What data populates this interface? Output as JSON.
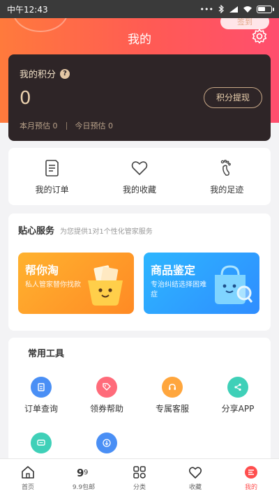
{
  "status": {
    "time": "中午12:43",
    "dots": "•••"
  },
  "header": {
    "title": "我的",
    "signin_label": "签到"
  },
  "points": {
    "label": "我的积分",
    "value": "0",
    "withdraw_label": "积分提现",
    "month_estimate": "本月预估 0",
    "today_estimate": "今日预估 0"
  },
  "quick_links": [
    {
      "label": "我的订单"
    },
    {
      "label": "我的收藏"
    },
    {
      "label": "我的足迹"
    }
  ],
  "service": {
    "title": "贴心服务",
    "subtitle": "为您提供1对1个性化管家服务",
    "tiles": [
      {
        "title": "帮你淘",
        "desc": "私人管家替你找款"
      },
      {
        "title": "商品鉴定",
        "desc": "专治纠结选择困难症"
      }
    ]
  },
  "tools": {
    "title": "常用工具",
    "items": [
      {
        "label": "订单查询",
        "color": "#4a8ff5"
      },
      {
        "label": "领券帮助",
        "color": "#ff6b7a"
      },
      {
        "label": "专属客服",
        "color": "#ffa63d"
      },
      {
        "label": "分享APP",
        "color": "#3fd0b8"
      },
      {
        "label": "",
        "color": "#3fd0b8"
      },
      {
        "label": "",
        "color": "#4a8ff5"
      }
    ]
  },
  "nav": [
    {
      "label": "首页"
    },
    {
      "label": "9.9包邮"
    },
    {
      "label": "分类"
    },
    {
      "label": "收藏"
    },
    {
      "label": "我的"
    }
  ],
  "colors": {
    "accent": "#ff4e4e",
    "gold": "#e4c7a4"
  }
}
